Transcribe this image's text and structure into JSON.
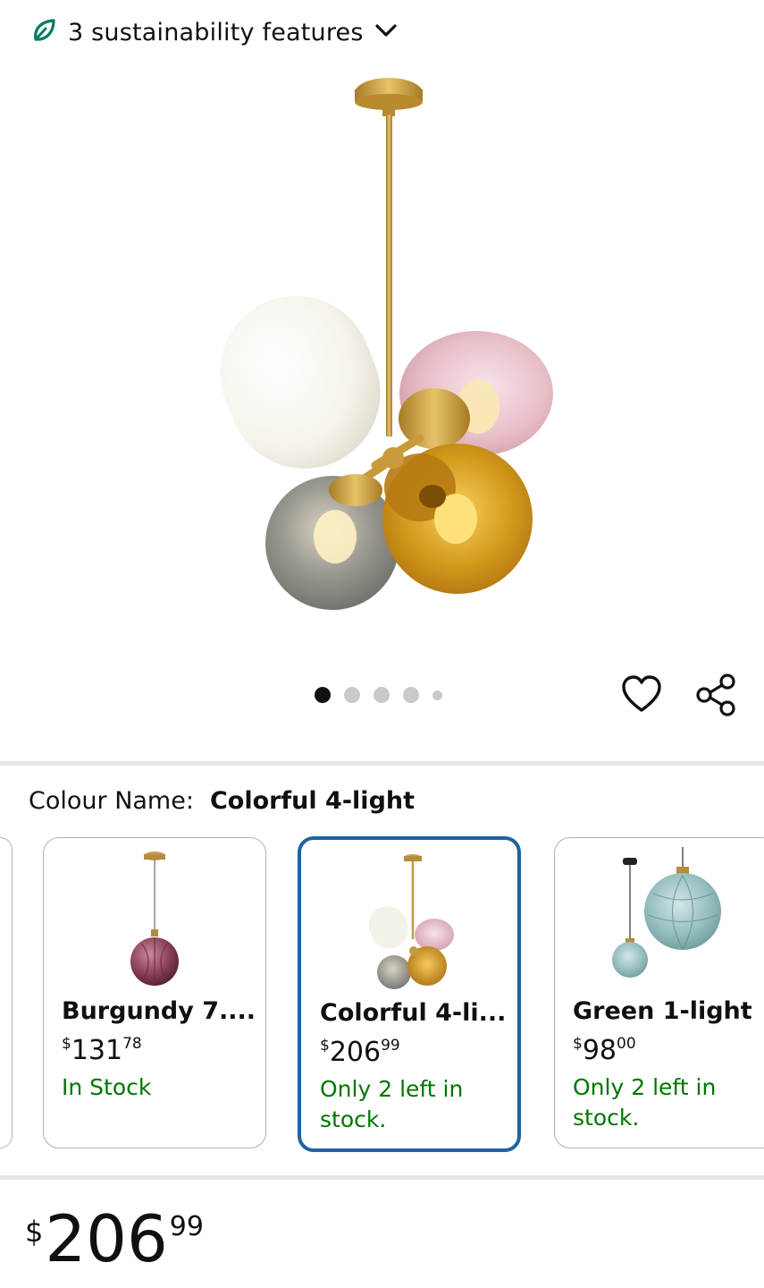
{
  "sustainability": {
    "label": "3 sustainability features",
    "icon": "leaf-icon",
    "accent": "#067d62"
  },
  "gallery": {
    "image_count": 5,
    "active_index": 0
  },
  "actions": {
    "favorite_icon": "heart-icon",
    "share_icon": "share-icon"
  },
  "colour": {
    "label": "Colour Name:",
    "value": "Colorful 4-light"
  },
  "variants": [
    {
      "name": "Burgundy 7....",
      "price_currency": "$",
      "price_whole": "131",
      "price_fraction": "78",
      "stock": "In Stock"
    },
    {
      "name": "Colorful 4-li...",
      "price_currency": "$",
      "price_whole": "206",
      "price_fraction": "99",
      "stock": "Only 2 left in stock.",
      "selected": true
    },
    {
      "name": "Green 1-light",
      "price_currency": "$",
      "price_whole": "98",
      "price_fraction": "00",
      "stock": "Only 2 left in stock."
    }
  ],
  "price": {
    "currency": "$",
    "whole": "206",
    "fraction": "99"
  },
  "colors": {
    "stock_green": "#007600",
    "selected_border": "#2162a1",
    "card_border": "#adb1b8"
  }
}
